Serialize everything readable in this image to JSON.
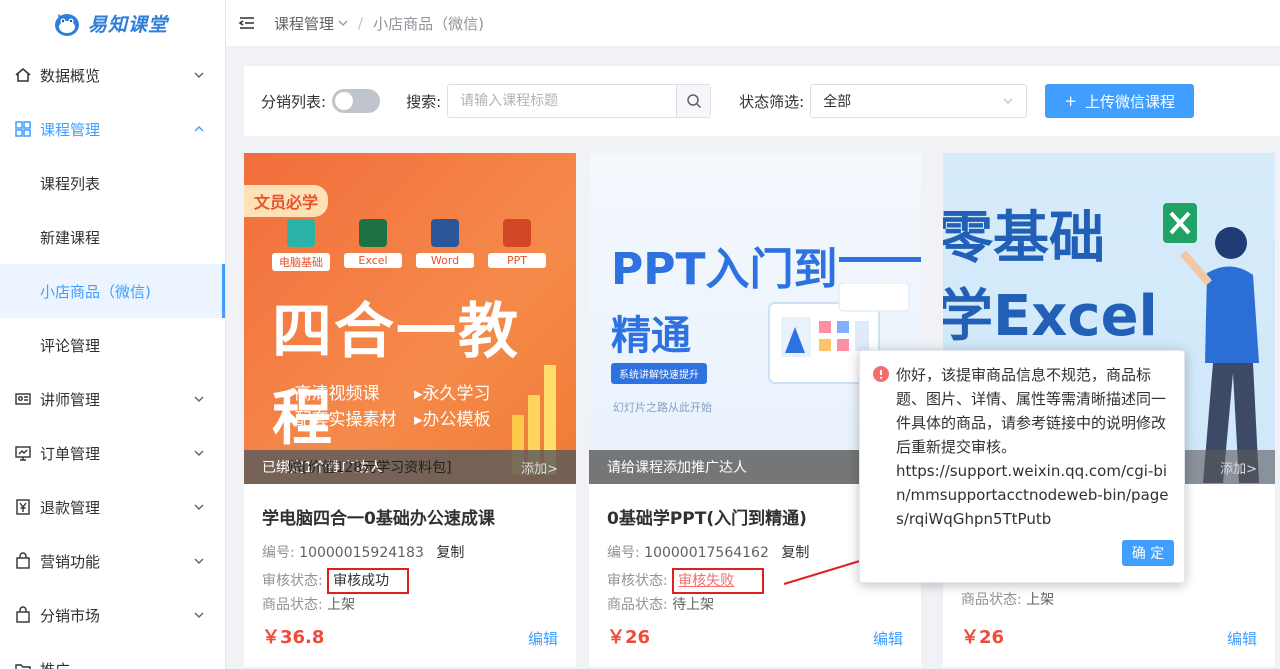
{
  "brand": {
    "name": "易知课堂"
  },
  "sidebar": {
    "items": [
      {
        "label": "数据概览",
        "icon": "home-icon"
      },
      {
        "label": "课程管理",
        "icon": "grid-icon"
      },
      {
        "label": "讲师管理",
        "icon": "id-card-icon"
      },
      {
        "label": "订单管理",
        "icon": "monitor-icon"
      },
      {
        "label": "退款管理",
        "icon": "yen-icon"
      },
      {
        "label": "营销功能",
        "icon": "bag-icon"
      },
      {
        "label": "分销市场",
        "icon": "bag-icon"
      },
      {
        "label": "推广",
        "icon": "folder-icon"
      }
    ],
    "sub_items": [
      {
        "label": "课程列表"
      },
      {
        "label": "新建课程"
      },
      {
        "label": "小店商品（微信)"
      },
      {
        "label": "评论管理"
      }
    ]
  },
  "header": {
    "breadcrumb": [
      "课程管理",
      "小店商品（微信)"
    ],
    "separator": "/"
  },
  "filter": {
    "distribution_label": "分销列表:",
    "search_label": "搜索:",
    "search_placeholder": "请输入课程标题",
    "status_label": "状态筛选:",
    "status_value": "全部",
    "upload_plus": "+",
    "upload_label": "上传微信课程"
  },
  "cards": [
    {
      "strip": "已绑定1个推广达人",
      "strip_overlay": "赠[价值128元学习资料包]",
      "add": "添加>",
      "title": "学电脑四合一0基础办公速成课",
      "id_label": "编号:",
      "id": "10000015924183",
      "copy": "复制",
      "audit_label": "审核状态:",
      "audit": "审核成功",
      "shelf_label": "商品状态:",
      "shelf": "上架",
      "price": "￥36.8",
      "edit": "编辑",
      "cover": {
        "tag": "文员必学",
        "apps": [
          "电脑基础",
          "Excel",
          "Word",
          "PPT"
        ],
        "headline": "四合一教程",
        "features": [
          "高清视频课",
          "永久学习",
          "配套实操素材",
          "办公模板"
        ]
      }
    },
    {
      "strip": "请给课程添加推广达人",
      "title": "0基础学PPT(入门到精通)",
      "id_label": "编号:",
      "id": "10000017564162",
      "copy": "复制",
      "audit_label": "审核状态:",
      "audit": "审核失败",
      "shelf_label": "商品状态:",
      "shelf": "待上架",
      "price": "￥26",
      "edit": "编辑",
      "cover": {
        "line1": "PPT入门到",
        "line2": "精通",
        "pill": "系统讲解快速提升",
        "sub": "幻灯片之路从此开始"
      }
    },
    {
      "add": "添加>",
      "shelf_label": "商品状态:",
      "shelf": "上架",
      "price": "￥26",
      "edit": "编辑",
      "cover": {
        "line1": "零基础",
        "line2": "学Excel"
      }
    }
  ],
  "popover": {
    "message": "你好，该提审商品信息不规范，商品标题、图片、详情、属性等需清晰描述同一件具体的商品，请参考链接中的说明修改后重新提交审核。",
    "link": "https://support.weixin.qq.com/cgi-bin/mmsupportacctnodeweb-bin/pages/rqiWqGhpn5TtPutb",
    "confirm": "确 定"
  },
  "colors": {
    "primary": "#409eff",
    "danger": "#f56c6c",
    "price": "#f04a3a",
    "highlight": "#e02020"
  }
}
